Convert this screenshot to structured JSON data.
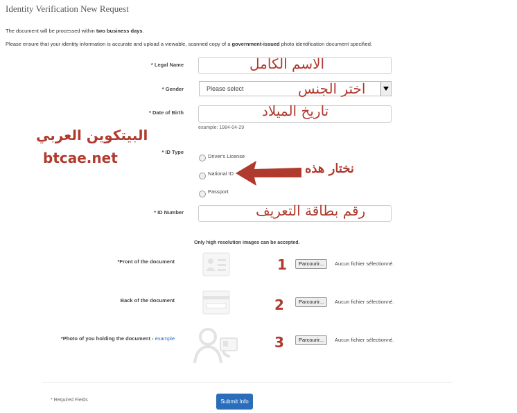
{
  "page": {
    "title": "Identity Verification New Request",
    "intro1_prefix": "The document will be processed within ",
    "intro1_bold": "two business days",
    "intro1_suffix": ".",
    "intro2_prefix": "Please ensure that your identity information is accurate and upload a viewable, scanned copy of a ",
    "intro2_bold": "government-issued",
    "intro2_suffix": " photo identification document specified."
  },
  "form": {
    "legal_name": {
      "label": "* Legal Name",
      "value": ""
    },
    "gender": {
      "label": "* Gender",
      "selected": "Please select"
    },
    "dob": {
      "label": "* Date of Birth",
      "value": "",
      "hint": "example: 1984-04-29"
    },
    "id_type": {
      "label": "* ID Type",
      "options": [
        "Driver's License",
        "National ID",
        "Passport"
      ]
    },
    "id_number": {
      "label": "* ID Number",
      "value": ""
    },
    "upload_note": "Only high resolution images can be accepted.",
    "uploads": [
      {
        "label": "*Front of the document",
        "button": "Parcourir...",
        "status": "Aucun fichier sélectionné."
      },
      {
        "label": "Back of the document",
        "button": "Parcourir...",
        "status": "Aucun fichier sélectionné."
      },
      {
        "label": "*Photo of you holding the document - ",
        "link": "example",
        "button": "Parcourir...",
        "status": "Aucun fichier sélectionné."
      }
    ],
    "required_note": "* Required Fields",
    "submit_label": "Submit Info"
  },
  "annotations": {
    "full_name": "الاسم الكامل",
    "choose_gender": "اختر الجنس",
    "birth_date": "تاريخ الميلاد",
    "choose_this": "نختار هذه",
    "id_card_number": "رقم بطاقة التعريف",
    "brand_arabic": "البيتكوين العربي",
    "brand_url": "btcae.net",
    "step1": "1",
    "step2": "2",
    "step3": "3"
  },
  "colors": {
    "annotation": "#b03a2e",
    "accent": "#2a6ebb"
  }
}
